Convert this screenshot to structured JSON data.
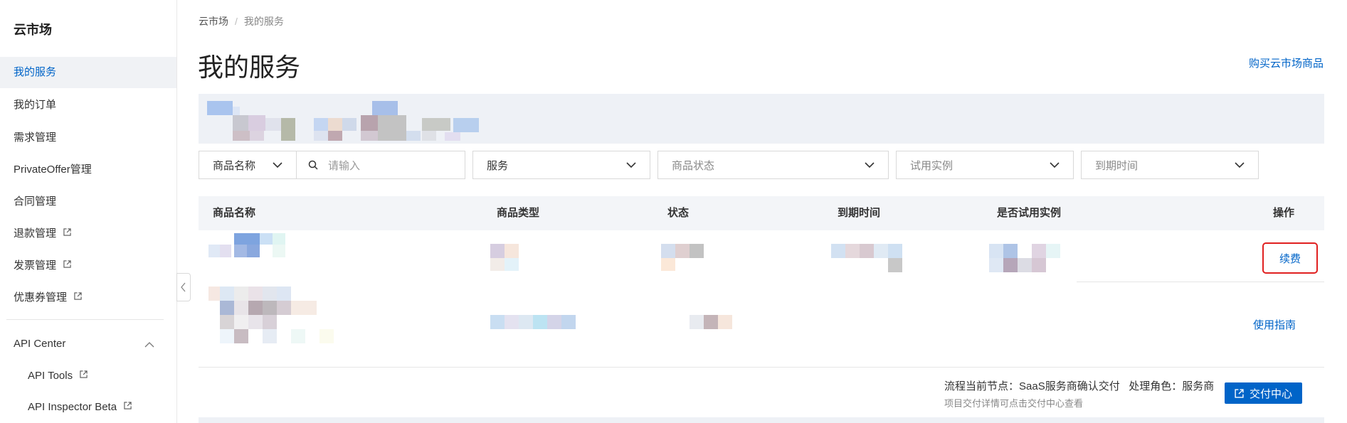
{
  "sidebar": {
    "title": "云市场",
    "items": [
      {
        "label": "我的服务"
      },
      {
        "label": "我的订单"
      },
      {
        "label": "需求管理"
      },
      {
        "label": "PrivateOffer管理"
      },
      {
        "label": "合同管理"
      },
      {
        "label": "退款管理"
      },
      {
        "label": "发票管理"
      },
      {
        "label": "优惠券管理"
      }
    ],
    "api_center": {
      "label": "API Center",
      "children": [
        {
          "label": "API Tools"
        },
        {
          "label": "API Inspector Beta"
        }
      ]
    }
  },
  "breadcrumb": {
    "root": "云市场",
    "current": "我的服务"
  },
  "page": {
    "title": "我的服务",
    "buy_link": "购买云市场商品"
  },
  "filters": {
    "field_select": "商品名称",
    "search_placeholder": "请输入",
    "service": "服务",
    "status": "商品状态",
    "trial": "试用实例",
    "expiry": "到期时间"
  },
  "table": {
    "headers": [
      "商品名称",
      "商品类型",
      "状态",
      "到期时间",
      "是否试用实例",
      "操作"
    ],
    "rows": [
      {
        "action": "续费"
      },
      {
        "action": "使用指南"
      }
    ]
  },
  "flow": {
    "text": "流程当前节点：SaaS服务商确认交付   处理角色：服务商",
    "sub": "项目交付详情可点击交付中心查看",
    "button": "交付中心"
  },
  "colors": {
    "accent": "#0064c8",
    "highlight": "#e02020",
    "header_bg": "#f3f5f8"
  },
  "icons": [
    "external-link-icon",
    "chevron-down-icon",
    "chevron-up-icon",
    "chevron-left-icon",
    "search-icon"
  ]
}
